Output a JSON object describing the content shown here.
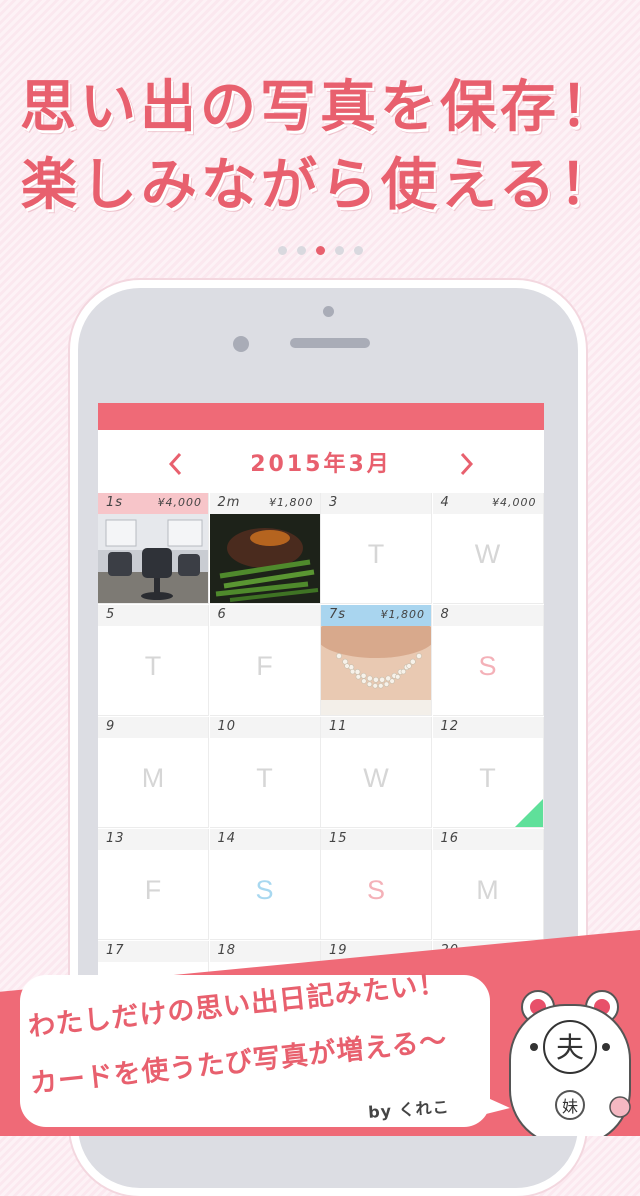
{
  "headline": {
    "line1": "思い出の写真を保存！",
    "line2": "楽しみながら使える！"
  },
  "pagination": {
    "total": 5,
    "active_index": 2
  },
  "calendar": {
    "prev_label": "‹",
    "next_label": "›",
    "month_label": "2015年3月",
    "days": [
      {
        "num": "1s",
        "amount": "¥4,000",
        "header": "pink",
        "photo": "salon-photo"
      },
      {
        "num": "2m",
        "amount": "¥1,800",
        "header": "plain",
        "photo": "steak-photo"
      },
      {
        "num": "3",
        "weekday": "T"
      },
      {
        "num": "4",
        "amount": "¥4,000",
        "weekday": "W"
      },
      {
        "num": "5",
        "weekday": "T"
      },
      {
        "num": "6",
        "weekday": "F"
      },
      {
        "num": "7s",
        "amount": "¥1,800",
        "header": "blue",
        "photo": "pearl-necklace-photo"
      },
      {
        "num": "8",
        "weekday": "S",
        "weekday_kind": "sun"
      },
      {
        "num": "9",
        "weekday": "M"
      },
      {
        "num": "10",
        "weekday": "T"
      },
      {
        "num": "11",
        "weekday": "W"
      },
      {
        "num": "12",
        "weekday": "T",
        "marker": "green-corner"
      },
      {
        "num": "13",
        "weekday": "F"
      },
      {
        "num": "14",
        "weekday": "S",
        "weekday_kind": "sat"
      },
      {
        "num": "15",
        "weekday": "S",
        "weekday_kind": "sun"
      },
      {
        "num": "16",
        "weekday": "M"
      },
      {
        "num": "17"
      },
      {
        "num": "18"
      },
      {
        "num": "19"
      },
      {
        "num": "20"
      }
    ]
  },
  "bubble": {
    "line1": "わたしだけの思い出日記みたい！",
    "line2": "カードを使うたび写真が増える〜",
    "byline": "by くれこ"
  },
  "mascot": {
    "label": "妹",
    "face_glyph": "夫"
  },
  "colors": {
    "accent": "#e8606e",
    "banner": "#ef6a77",
    "marker_green": "#5fe09a",
    "saturday": "#a8d8f0",
    "sunday": "#f4b1b8"
  }
}
